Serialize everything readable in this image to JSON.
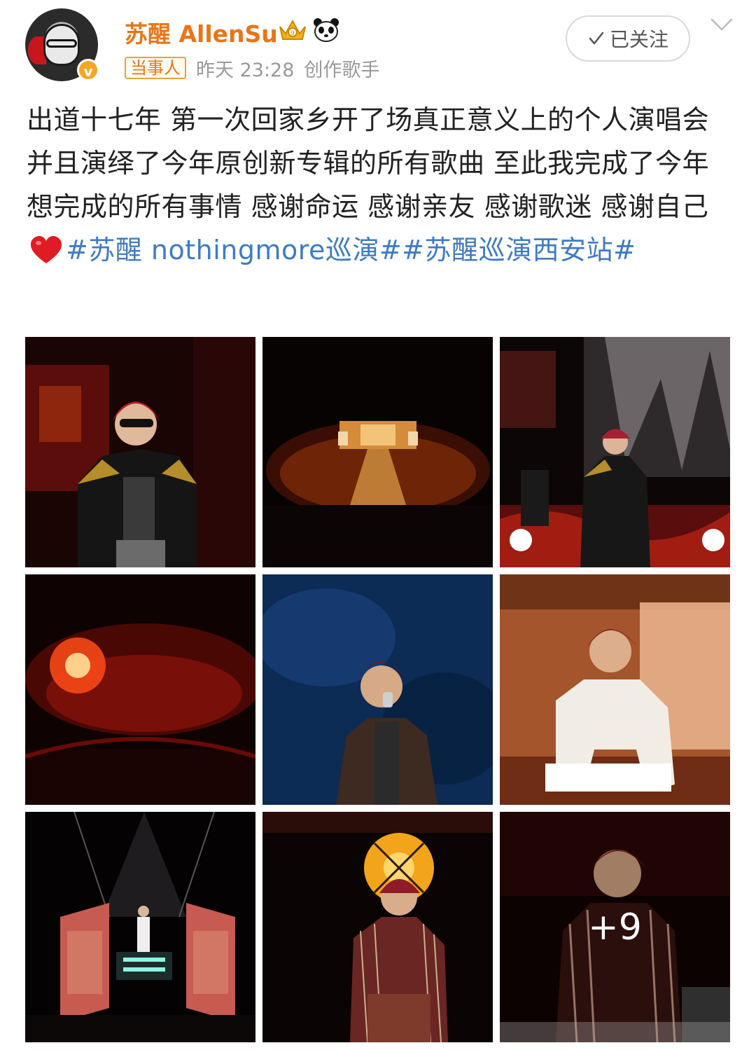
{
  "post": {
    "user": {
      "name": "苏醒 AllenSu",
      "verified_badge": "v",
      "tag": "当事人",
      "time": "昨天 23:28",
      "role": "创作歌手"
    },
    "follow_label": "已关注",
    "text_segments": [
      {
        "text": "出道十七年 第一次回家乡开了场真正意义上的个人演唱会 并且演绎了今年原创新专辑的所有歌曲 至此我完成了今年想完成的所有事情 感谢命运 感谢亲友 感谢歌迷 感谢自己",
        "type": "plain"
      },
      {
        "text": "#苏醒 nothingmore巡演#",
        "type": "topic"
      },
      {
        "text": "#苏醒巡演西安站#",
        "type": "topic"
      }
    ],
    "images_more_label": "+9",
    "icons": [
      "crown-icon",
      "panda-icon",
      "check-icon",
      "chevron-down-icon",
      "heart-icon"
    ],
    "colors": {
      "username": "#e8751a",
      "topic": "#3f7bc2",
      "badge": "#f5a623"
    }
  }
}
